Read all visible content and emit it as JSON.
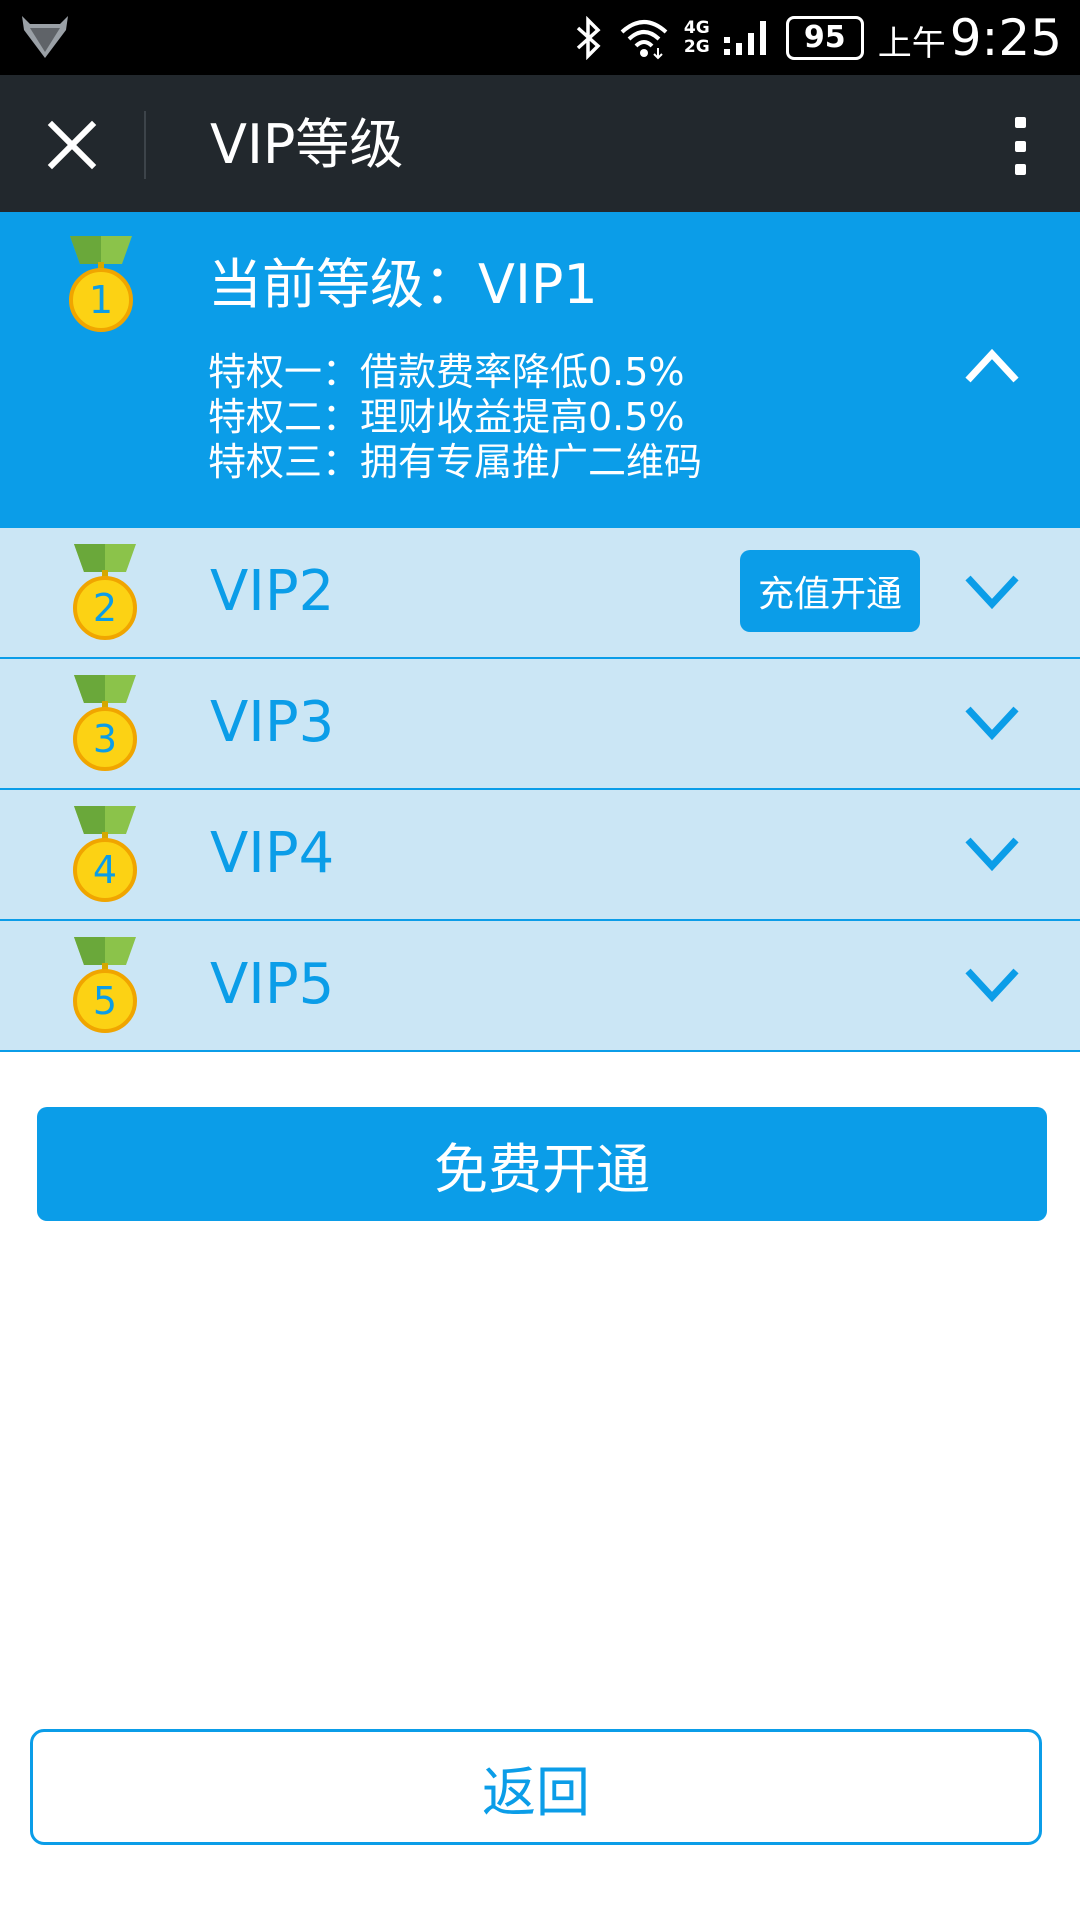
{
  "status_bar": {
    "network_top": "4G",
    "network_bottom": "2G",
    "battery": "95",
    "am_pm": "上午",
    "time": "9:25"
  },
  "header": {
    "title": "VIP等级"
  },
  "current_level": {
    "medal_number": "1",
    "title": "当前等级：VIP1",
    "privileges": [
      "特权一：借款费率降低0.5%",
      "特权二：理财收益提高0.5%",
      "特权三：拥有专属推广二维码"
    ]
  },
  "levels": [
    {
      "medal_number": "2",
      "label": "VIP2",
      "action_label": "充值开通"
    },
    {
      "medal_number": "3",
      "label": "VIP3"
    },
    {
      "medal_number": "4",
      "label": "VIP4"
    },
    {
      "medal_number": "5",
      "label": "VIP5"
    }
  ],
  "primary_button": "免费开通",
  "back_button": "返回",
  "colors": {
    "accent": "#0b9de8",
    "row_background": "#cbe6f5",
    "header_background": "#22282d",
    "medal_gold": "#fcd214",
    "ribbon_green": "#8bc34a"
  }
}
